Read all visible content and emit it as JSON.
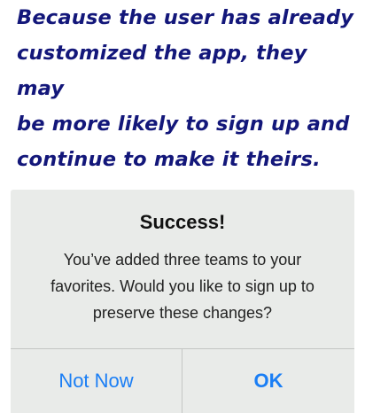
{
  "annotation": {
    "lines": [
      "Because the user has already",
      "customized the app, they may",
      "be more likely to sign up and",
      "continue to make it theirs."
    ],
    "color": "#13177a"
  },
  "alert": {
    "title": "Success!",
    "message_lines": [
      "You’ve added three teams to your",
      "favorites. Would you like to sign up to",
      "preserve these changes?"
    ],
    "buttons": {
      "cancel_label": "Not Now",
      "confirm_label": "OK"
    },
    "background_color": "#e9ebe9",
    "button_color": "#1a7ef5"
  }
}
